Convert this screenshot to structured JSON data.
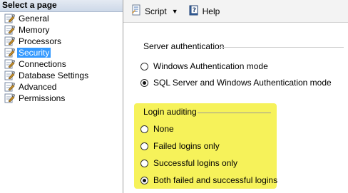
{
  "left_pane": {
    "header": "Select a page",
    "pages": [
      {
        "label": "General",
        "icon": "wrench-page-icon"
      },
      {
        "label": "Memory",
        "icon": "wrench-page-icon"
      },
      {
        "label": "Processors",
        "icon": "wrench-page-icon"
      },
      {
        "label": "Security",
        "icon": "wrench-page-icon",
        "selected": true
      },
      {
        "label": "Connections",
        "icon": "wrench-page-icon"
      },
      {
        "label": "Database Settings",
        "icon": "wrench-page-icon"
      },
      {
        "label": "Advanced",
        "icon": "wrench-page-icon"
      },
      {
        "label": "Permissions",
        "icon": "wrench-page-icon"
      }
    ]
  },
  "toolbar": {
    "script_label": "Script",
    "help_label": "Help"
  },
  "server_auth": {
    "title": "Server authentication",
    "options": [
      {
        "label": "Windows Authentication mode",
        "checked": false
      },
      {
        "label": "SQL Server and Windows Authentication mode",
        "checked": true
      }
    ]
  },
  "login_auditing": {
    "title": "Login auditing",
    "highlight_color": "#f6f25a",
    "options": [
      {
        "label": "None",
        "checked": false
      },
      {
        "label": "Failed logins only",
        "checked": false
      },
      {
        "label": "Successful logins only",
        "checked": false
      },
      {
        "label": "Both failed and successful logins",
        "checked": true
      }
    ]
  },
  "colors": {
    "selection": "#3399ff",
    "highlight": "#f6f25a"
  }
}
